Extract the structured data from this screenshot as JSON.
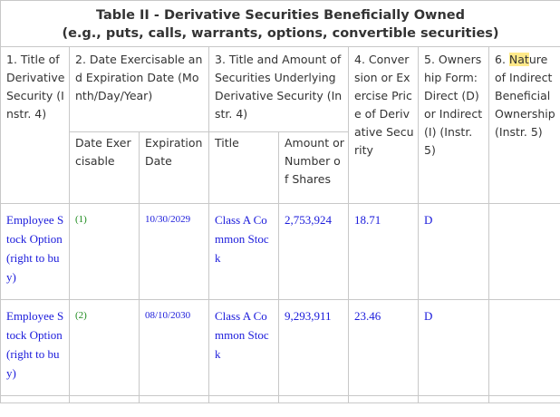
{
  "table": {
    "title_line1": "Table II - Derivative Securities Beneficially Owned",
    "title_line2": "(e.g., puts, calls, warrants, options, convertible securities)",
    "col1": "1. Title of Derivative Security (Instr. 4)",
    "col2": "2. Date Exercisable and Expiration Date (Month/Day/Year)",
    "col3": "3. Title and Amount of Securities Underlying Derivative Security (Instr. 4)",
    "col4": "4. Conversion or Exercise Price of Derivative Security",
    "col5": "5. Ownership Form: Direct (D) or Indirect (I) (Instr. 5)",
    "col6_pre": "6. ",
    "col6_hl": "Nat",
    "col6_post": "ure of Indirect Beneficial Ownership (Instr. 5)",
    "sub_date_exercisable": "Date Exercisable",
    "sub_expiration_date": "Expiration Date",
    "sub_title": "Title",
    "sub_amount": "Amount or Number of Shares",
    "rows": [
      {
        "security": "Employee Stock Option (right to buy)",
        "date_exercisable": "(1)",
        "expiration_date": "10/30/2029",
        "underlying_title": "Class A Common Stock",
        "amount": "2,753,924",
        "price": "18.71",
        "ownership": "D",
        "nature": ""
      },
      {
        "security": "Employee Stock Option (right to buy)",
        "date_exercisable": "(2)",
        "expiration_date": "08/10/2030",
        "underlying_title": "Class A Common Stock",
        "amount": "9,293,911",
        "price": "23.46",
        "ownership": "D",
        "nature": ""
      }
    ]
  }
}
